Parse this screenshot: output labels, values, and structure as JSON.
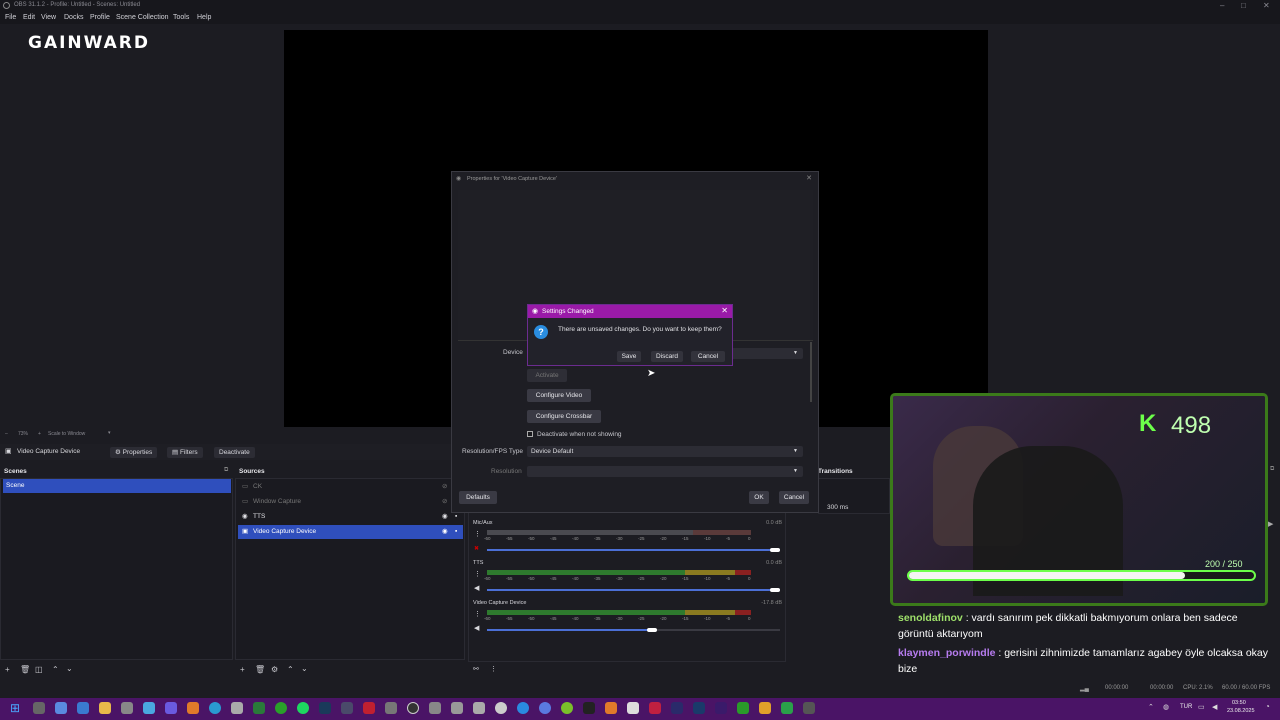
{
  "window": {
    "title": "OBS 31.1.2 - Profile: Untitled - Scenes: Untitled"
  },
  "menu": [
    "File",
    "Edit",
    "View",
    "Docks",
    "Profile",
    "Scene Collection",
    "Tools",
    "Help"
  ],
  "logo": "GAINWARD",
  "preview_bar": {
    "zoom": "73%",
    "scale_mode": "Scale to Window"
  },
  "source_toolbar": {
    "current_source": "Video Capture Device",
    "properties": "Properties",
    "filters": "Filters",
    "deactivate": "Deactivate"
  },
  "scenes": {
    "title": "Scenes",
    "items": [
      "Scene"
    ]
  },
  "sources": {
    "title": "Sources",
    "items": [
      "CK",
      "Window Capture",
      "TTS",
      "Video Capture Device"
    ]
  },
  "transitions": {
    "title": "Transitions",
    "duration": "300 ms"
  },
  "mixer": {
    "channels": [
      {
        "name": "Mic/Aux",
        "db": "0.0 dB",
        "level": 0.0,
        "volume": 1.0
      },
      {
        "name": "TTS",
        "db": "0.0 dB",
        "level": 0.0,
        "volume": 1.0
      },
      {
        "name": "Video Capture Device",
        "db": "-17.8 dB",
        "level": 0.0,
        "volume": 0.55
      }
    ],
    "scale": [
      "-60",
      "-55",
      "-50",
      "-45",
      "-40",
      "-35",
      "-30",
      "-25",
      "-20",
      "-15",
      "-10",
      "-5",
      "0"
    ]
  },
  "properties_dialog": {
    "title": "Properties for 'Video Capture Device'",
    "device_label": "Device",
    "activate": "Activate",
    "configure_video": "Configure Video",
    "configure_crossbar": "Configure Crossbar",
    "deactivate_when_not_showing": "Deactivate when not showing",
    "resolution_fps_type_label": "Resolution/FPS Type",
    "resolution_fps_type_value": "Device Default",
    "resolution_label": "Resolution",
    "defaults": "Defaults",
    "ok": "OK",
    "cancel": "Cancel"
  },
  "settings_changed": {
    "title": "Settings Changed",
    "message": "There are unsaved changes. Do you want to keep them?",
    "save": "Save",
    "discard": "Discard",
    "cancel": "Cancel"
  },
  "webcam_overlay": {
    "counter": "498",
    "progress_text": "200 / 250",
    "progress": 0.8
  },
  "chat": [
    {
      "user": "senoldafinov",
      "user_color": "#9ee06a",
      "text": ": vardı sanırım pek dikkatli bakmıyorum onlara ben sadece görüntü aktarıyom"
    },
    {
      "user": "klaymen_porwindle",
      "user_color": "#b77cf0",
      "text": ": gerisini zihnimizde tamamlarız agabey öyle olcaksa okay bize"
    }
  ],
  "status": {
    "t1": "00:00:00",
    "t2": "00:00:00",
    "cpu": "CPU: 2.1%",
    "fps": "60.00 / 60.00 FPS"
  },
  "taskbar": {
    "lang": "TUR",
    "time": "03:50",
    "date": "23.08.2025"
  },
  "colors": {
    "accent": "#2f4fbd",
    "dialog_header": "#9a1aa8",
    "taskbar": "#4a1466",
    "cam_border": "#3b7a1a"
  }
}
